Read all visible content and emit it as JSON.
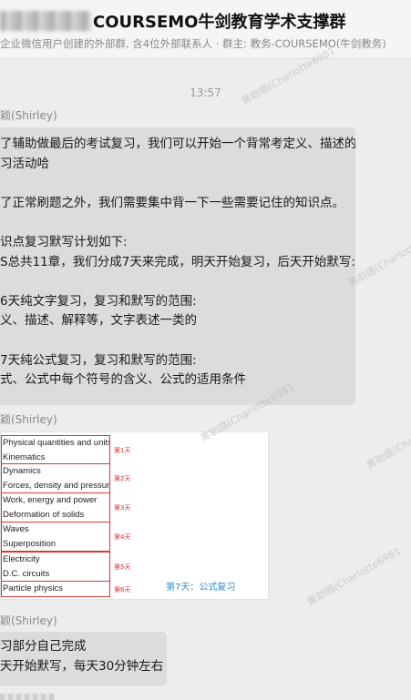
{
  "header": {
    "title": "COURSEMO牛剑教育学术支撑群",
    "subtitle": "企业微信用户创建的外部群, 含4位外部联系人 · 群主: 教务-COURSEMO(牛剑教务)"
  },
  "time": "13:57",
  "watermark": "黄助璐(Charlotte6981",
  "messages": [
    {
      "sender": "颖(Shirley)",
      "lines": [
        "了辅助做最后的考试复习，我们可以开始一个背常考定义、描述的",
        "习活动哈",
        "",
        "了正常刷题之外，我们需要集中背一下一些需要记住的知识点。",
        "",
        "识点复习默写计划如下:",
        "S总共11章，我们分成7天来完成，明天开始复习，后天开始默写:",
        "",
        "6天纯文字复习，复习和默写的范围:",
        "义、描述、解释等，文字表述一类的",
        "",
        "7天纯公式复习，复习和默写的范围:",
        "式、公式中每个符号的含义、公式的适用条件"
      ]
    },
    {
      "sender": "颖(Shirley)",
      "image": {
        "groups": [
          {
            "items": [
              "Physical quantities and units",
              "Kinematics"
            ],
            "day": "第1天"
          },
          {
            "items": [
              "Dynamics",
              "Forces, density and pressure"
            ],
            "day": "第2天"
          },
          {
            "items": [
              "Work, energy and power",
              "Deformation of solids"
            ],
            "day": "第3天"
          },
          {
            "items": [
              "Waves",
              "Superposition"
            ],
            "day": "第4天"
          },
          {
            "items": [
              "Electricity",
              "D.C. circuits"
            ],
            "day": "第5天"
          },
          {
            "items": [
              "Particle physics"
            ],
            "day": "第6天"
          }
        ],
        "day7": "第7天：公式复习"
      }
    },
    {
      "sender": "颖(Shirley)",
      "lines": [
        "习部分自己完成",
        "天开始默写，每天30分钟左右"
      ]
    }
  ]
}
